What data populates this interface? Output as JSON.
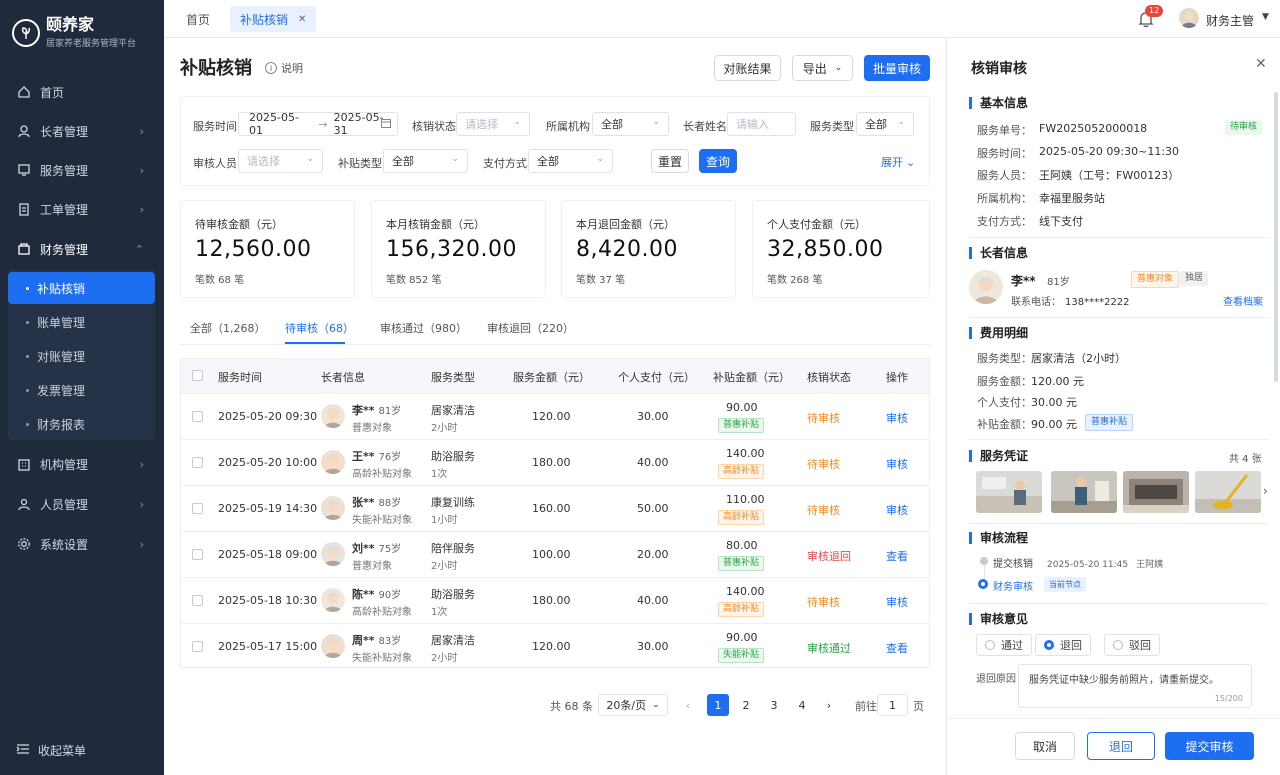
{
  "app": {
    "name": "颐养家",
    "subtitle": "居家养老服务管理平台"
  },
  "sidebar": {
    "items": [
      {
        "label": "首页",
        "icon": "home-icon"
      },
      {
        "label": "长者管理",
        "icon": "user-icon"
      },
      {
        "label": "服务管理",
        "icon": "service-icon"
      },
      {
        "label": "工单管理",
        "icon": "clipboard-icon"
      },
      {
        "label": "财务管理",
        "icon": "wallet-icon"
      },
      {
        "label": "机构管理",
        "icon": "building-icon"
      },
      {
        "label": "人员管理",
        "icon": "people-icon"
      },
      {
        "label": "系统设置",
        "icon": "gear-icon"
      }
    ],
    "finance_sub": [
      "补贴核销",
      "账单管理",
      "对账管理",
      "发票管理",
      "财务报表"
    ],
    "collapse_label": "收起菜单"
  },
  "topbar": {
    "tabs": [
      {
        "label": "首页"
      },
      {
        "label": "补贴核销"
      }
    ],
    "notification_count": "12",
    "user_name": "财务主管"
  },
  "page": {
    "title": "补贴核销",
    "help_label": "说明",
    "buttons": {
      "reconcile": "对账结果",
      "export": "导出",
      "batch": "批量审核"
    }
  },
  "filters": {
    "service_time_label": "服务时间",
    "date_start": "2025-05-01",
    "date_sep": "→",
    "date_end": "2025-05-31",
    "status_label": "核销状态",
    "status_placeholder": "请选择",
    "org_label": "所属机构",
    "org_value": "全部",
    "elder_label": "长者姓名",
    "elder_placeholder": "请输入",
    "type_label": "服务类型",
    "type_value": "全部",
    "reviewer_label": "审核人员",
    "reviewer_placeholder": "请选择",
    "subsidy_label": "补贴类型",
    "subsidy_value": "全部",
    "pay_label": "支付方式",
    "pay_value": "全部",
    "reset": "重置",
    "query": "查询",
    "expand": "展开"
  },
  "stats": [
    {
      "title": "待审核金额（元）",
      "value": "12,560.00",
      "count": "笔数  68 笔"
    },
    {
      "title": "本月核销金额（元）",
      "value": "156,320.00",
      "count": "笔数  852 笔"
    },
    {
      "title": "本月退回金额（元）",
      "value": "8,420.00",
      "count": "笔数  37 笔"
    },
    {
      "title": "个人支付金额（元）",
      "value": "32,850.00",
      "count": "笔数  268 笔"
    }
  ],
  "status_tabs": [
    "全部（1,268）",
    "待审核（68）",
    "审核通过（980）",
    "审核退回（220）"
  ],
  "table": {
    "headers": [
      "服务时间",
      "长者信息",
      "服务类型",
      "服务金额（元）",
      "个人支付（元）",
      "补贴金额（元）",
      "核销状态",
      "操作"
    ],
    "rows": [
      {
        "time": "2025-05-20 09:30",
        "name": "李**",
        "age": "81岁",
        "cat": "普惠对象",
        "svc": "居家清洁",
        "dur": "2小时",
        "amt": "120.00",
        "pay": "30.00",
        "sub": "90.00",
        "stag": "普惠补贴",
        "status": "待审核",
        "op": "审核"
      },
      {
        "time": "2025-05-20 10:00",
        "name": "王**",
        "age": "76岁",
        "cat": "高龄补贴对象",
        "svc": "助浴服务",
        "dur": "1次",
        "amt": "180.00",
        "pay": "40.00",
        "sub": "140.00",
        "stag": "高龄补贴",
        "status": "待审核",
        "op": "审核"
      },
      {
        "time": "2025-05-19 14:30",
        "name": "张**",
        "age": "88岁",
        "cat": "失能补贴对象",
        "svc": "康复训练",
        "dur": "1小时",
        "amt": "160.00",
        "pay": "50.00",
        "sub": "110.00",
        "stag": "高龄补贴",
        "status": "待审核",
        "op": "审核"
      },
      {
        "time": "2025-05-18 09:00",
        "name": "刘**",
        "age": "75岁",
        "cat": "普惠对象",
        "svc": "陪伴服务",
        "dur": "2小时",
        "amt": "100.00",
        "pay": "20.00",
        "sub": "80.00",
        "stag": "普惠补贴",
        "status": "审核退回",
        "op": "查看"
      },
      {
        "time": "2025-05-18 10:30",
        "name": "陈**",
        "age": "90岁",
        "cat": "高龄补贴对象",
        "svc": "助浴服务",
        "dur": "1次",
        "amt": "180.00",
        "pay": "40.00",
        "sub": "140.00",
        "stag": "高龄补贴",
        "status": "待审核",
        "op": "审核"
      },
      {
        "time": "2025-05-17 15:00",
        "name": "周**",
        "age": "83岁",
        "cat": "失能补贴对象",
        "svc": "居家清洁",
        "dur": "2小时",
        "amt": "120.00",
        "pay": "30.00",
        "sub": "90.00",
        "stag": "失能补贴",
        "status": "审核通过",
        "op": "查看"
      }
    ]
  },
  "pagination": {
    "total": "共 68 条",
    "size": "20条/页",
    "pages": [
      "1",
      "2",
      "3",
      "4"
    ],
    "goto_label": "前往",
    "goto_value": "1",
    "goto_unit": "页",
    "prev": "‹",
    "next": "›"
  },
  "panel": {
    "title": "核销审核",
    "basic_title": "基本信息",
    "basic": [
      {
        "k": "服务单号：",
        "v": "FW2025052000018"
      },
      {
        "k": "服务时间：",
        "v": "2025-05-20  09:30~11:30"
      },
      {
        "k": "服务人员：",
        "v": "王阿姨（工号：FW00123）"
      },
      {
        "k": "所属机构：",
        "v": "幸福里服务站"
      },
      {
        "k": "支付方式：",
        "v": "线下支付"
      }
    ],
    "status_tag": "待审核",
    "elder_title": "长者信息",
    "elder": {
      "name": "李**",
      "age": "81岁",
      "tag1": "普惠对象",
      "tag2": "独居",
      "phone_label": "联系电话：",
      "phone": "138****2222",
      "link": "查看档案"
    },
    "fee_title": "费用明细",
    "fees": [
      {
        "k": "服务类型：",
        "v": "居家清洁（2小时）"
      },
      {
        "k": "服务金额：",
        "v": "120.00 元"
      },
      {
        "k": "个人支付：",
        "v": "30.00 元"
      },
      {
        "k": "补贴金额：",
        "v": "90.00 元"
      }
    ],
    "fee_tag": "普惠补贴",
    "proof_title": "服务凭证",
    "proof_count": "共 4 张",
    "flow_title": "审核流程",
    "flow": [
      {
        "label": "提交核销",
        "time": "2025-05-20 11:45",
        "who": "王阿姨"
      },
      {
        "label": "财务审核",
        "badge": "当前节点"
      }
    ],
    "opinion_title": "审核意见",
    "options": [
      "通过",
      "退回",
      "驳回"
    ],
    "reason_label": "退回原因",
    "reason_text": "服务凭证中缺少服务前照片，请重新提交。",
    "reason_count": "15/200",
    "buttons": {
      "cancel": "取消",
      "return": "退回",
      "submit": "提交审核"
    }
  },
  "colors": {
    "primary": "#1e6ef2",
    "sidebar": "#1f2a3d",
    "warning": "#f08a24",
    "danger": "#e5484d",
    "success": "#28a745"
  }
}
